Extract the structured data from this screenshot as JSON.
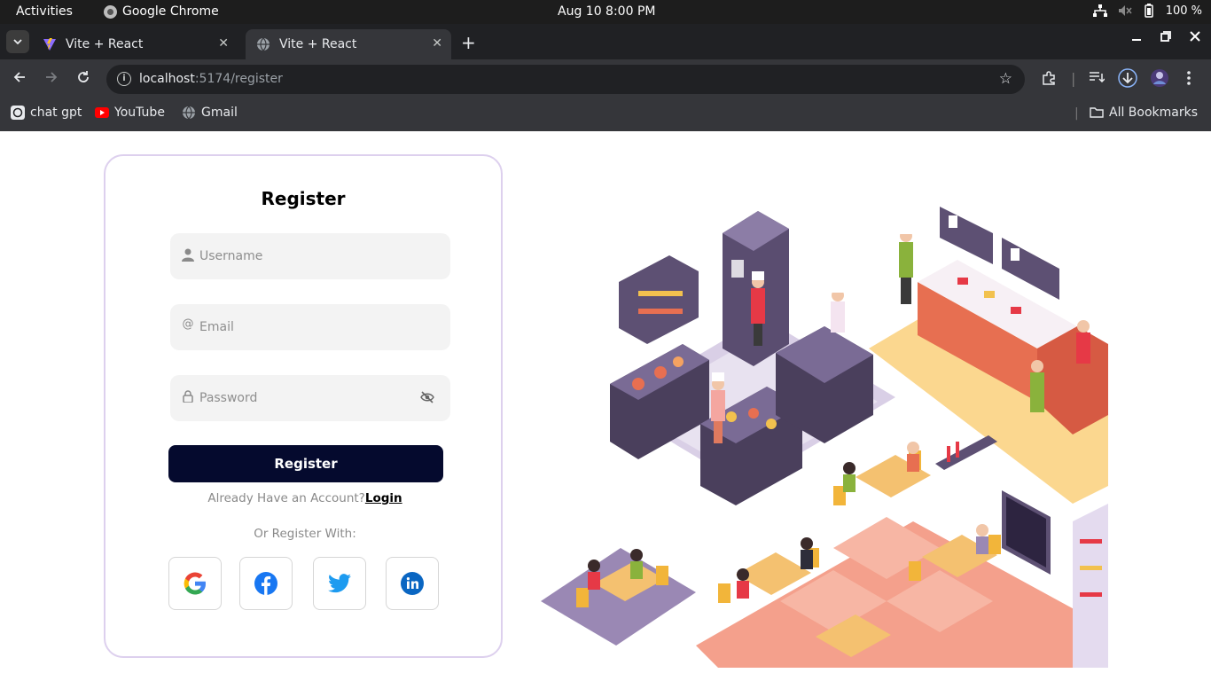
{
  "system_bar": {
    "activities": "Activities",
    "app_name": "Google Chrome",
    "clock": "Aug 10  8:00 PM",
    "battery": "100 %"
  },
  "browser": {
    "tabs": [
      {
        "title": "Vite + React"
      },
      {
        "title": "Vite + React"
      }
    ],
    "url_host": "localhost",
    "url_rest": ":5174/register",
    "bookmarks": [
      {
        "label": "chat gpt"
      },
      {
        "label": "YouTube"
      },
      {
        "label": "Gmail"
      }
    ],
    "all_bookmarks": "All Bookmarks"
  },
  "form": {
    "title": "Register",
    "username_placeholder": "Username",
    "email_placeholder": "Email",
    "password_placeholder": "Password",
    "submit_label": "Register",
    "already_text": "Already Have an Account?",
    "login_link": "Login",
    "or_text": "Or Register With:"
  },
  "social": {
    "providers": [
      "google",
      "facebook",
      "twitter",
      "linkedin"
    ]
  },
  "colors": {
    "button": "#050a2e",
    "card_border": "#ddd0ee",
    "field_bg": "#f3f3f3",
    "facebook": "#1877f2",
    "twitter": "#1d9bf0",
    "linkedin": "#0a66c2"
  }
}
